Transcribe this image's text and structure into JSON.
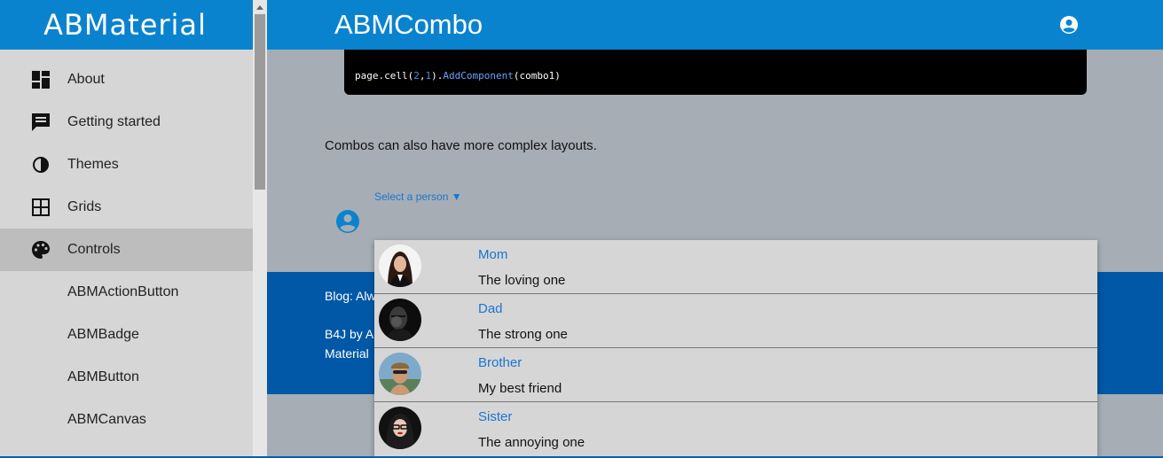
{
  "brand": {
    "name": "ABMaterial"
  },
  "sidebar": {
    "items": [
      {
        "label": "About",
        "icon": "dashboard-icon"
      },
      {
        "label": "Getting started",
        "icon": "chat-icon"
      },
      {
        "label": "Themes",
        "icon": "contrast-icon"
      },
      {
        "label": "Grids",
        "icon": "grid-icon"
      },
      {
        "label": "Controls",
        "icon": "palette-icon",
        "active": true
      }
    ],
    "subitems": [
      {
        "label": "ABMActionButton"
      },
      {
        "label": "ABMBadge"
      },
      {
        "label": "ABMButton"
      },
      {
        "label": "ABMCanvas"
      }
    ]
  },
  "header": {
    "title": "ABMCombo",
    "account_icon": "account-circle-icon"
  },
  "code": {
    "prefix": "page.cell(",
    "arg1": "2",
    "comma": ",",
    "arg2": "1",
    "mid": ").",
    "method": "AddComponent",
    "suffix": "(combo1)"
  },
  "main": {
    "paragraph": "Combos can also have more complex layouts.",
    "combo_label": "Select a person ▼"
  },
  "footer": {
    "blog": "Blog: Alw",
    "b4j": "B4J by A",
    "material": "Material"
  },
  "dropdown": {
    "options": [
      {
        "name": "Mom",
        "desc": "The loving one"
      },
      {
        "name": "Dad",
        "desc": "The strong one"
      },
      {
        "name": "Brother",
        "desc": "My best friend"
      },
      {
        "name": "Sister",
        "desc": "The annoying one"
      }
    ]
  },
  "colors": {
    "primary": "#0a83cf",
    "footer": "#0058a6",
    "accent_text": "#1976d2"
  }
}
